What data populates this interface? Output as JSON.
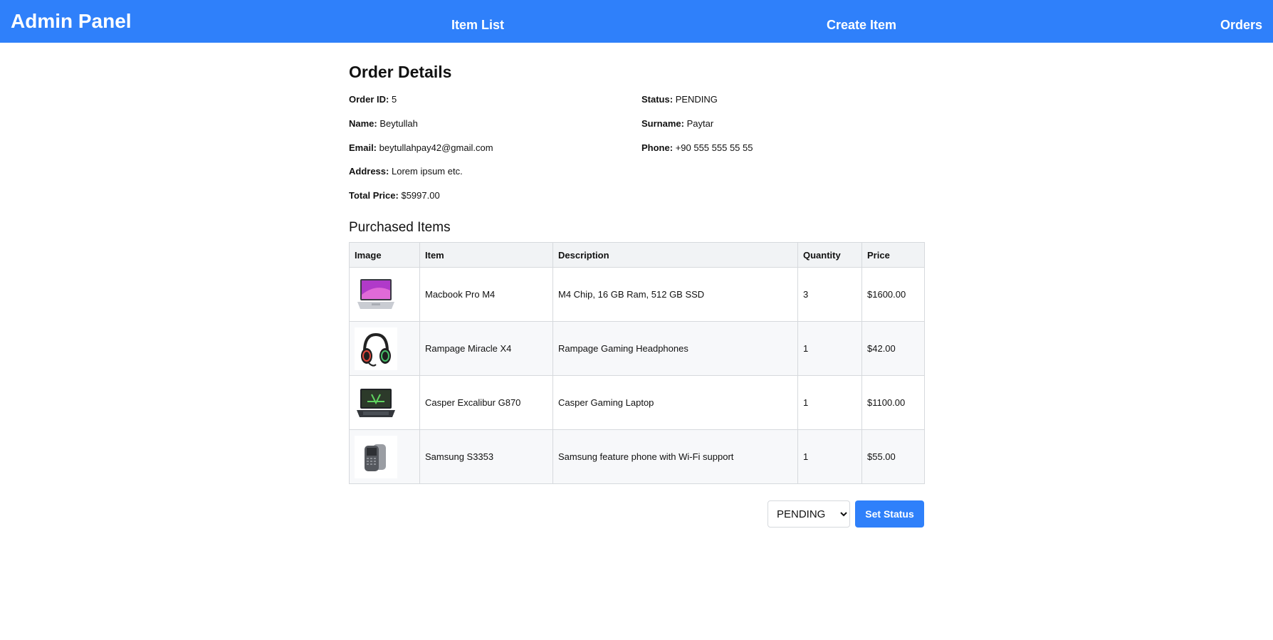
{
  "colors": {
    "primary": "#2f80fa",
    "header_bg": "#f1f3f5",
    "stripe_bg": "#f7f8fa"
  },
  "nav": {
    "brand": "Admin Panel",
    "links": [
      "Item List",
      "Create Item",
      "Orders"
    ]
  },
  "order": {
    "title": "Order Details",
    "fields": {
      "order_id": {
        "label": "Order ID:",
        "value": "5"
      },
      "name": {
        "label": "Name:",
        "value": "Beytullah"
      },
      "email": {
        "label": "Email:",
        "value": "beytullahpay42@gmail.com"
      },
      "address": {
        "label": "Address:",
        "value": "Lorem ipsum etc."
      },
      "total_price": {
        "label": "Total Price:",
        "value": "$5997.00"
      },
      "status": {
        "label": "Status:",
        "value": "PENDING"
      },
      "surname": {
        "label": "Surname:",
        "value": "Paytar"
      },
      "phone": {
        "label": "Phone:",
        "value": "+90 555 555 55 55"
      }
    }
  },
  "purchased": {
    "title": "Purchased Items",
    "columns": [
      "Image",
      "Item",
      "Description",
      "Quantity",
      "Price"
    ],
    "rows": [
      {
        "image_icon": "laptop-icon",
        "item": "Macbook Pro M4",
        "description": "M4 Chip, 16 GB Ram, 512 GB SSD",
        "quantity": "3",
        "price": "$1600.00"
      },
      {
        "image_icon": "headphones-icon",
        "item": "Rampage Miracle X4",
        "description": "Rampage Gaming Headphones",
        "quantity": "1",
        "price": "$42.00"
      },
      {
        "image_icon": "gaming-laptop-icon",
        "item": "Casper Excalibur G870",
        "description": "Casper Gaming Laptop",
        "quantity": "1",
        "price": "$1100.00"
      },
      {
        "image_icon": "phone-icon",
        "item": "Samsung S3353",
        "description": "Samsung feature phone with Wi-Fi support",
        "quantity": "1",
        "price": "$55.00"
      }
    ]
  },
  "status_control": {
    "selected": "PENDING",
    "button_label": "Set Status"
  }
}
